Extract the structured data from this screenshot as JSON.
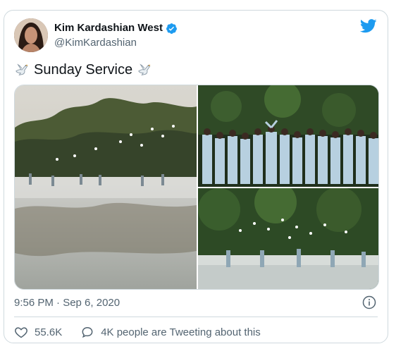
{
  "tweet": {
    "display_name": "Kim Kardashian West",
    "handle": "@KimKardashian",
    "text": "Sunday Service",
    "timestamp": "9:56 PM · Sep 6, 2020",
    "likes": "55.6K",
    "conversation": "4K people are Tweeting about this"
  },
  "icons": {
    "verified": "verified-badge-icon",
    "brand": "twitter-bird-icon",
    "emoji": "dove-icon",
    "info": "info-icon",
    "like": "heart-icon",
    "reply": "speech-bubble-icon"
  },
  "colors": {
    "brand_blue": "#1d9bf0",
    "text": "#0f1419",
    "secondary": "#536471",
    "border": "#cfd9de"
  },
  "media": [
    {
      "id": "photo-1",
      "subject": "figures in white standing in misty lake with doves"
    },
    {
      "id": "photo-2",
      "subject": "group in light blue outfits raising hands in forest"
    },
    {
      "id": "photo-3",
      "subject": "figures in misty lake with doves flying above"
    }
  ]
}
